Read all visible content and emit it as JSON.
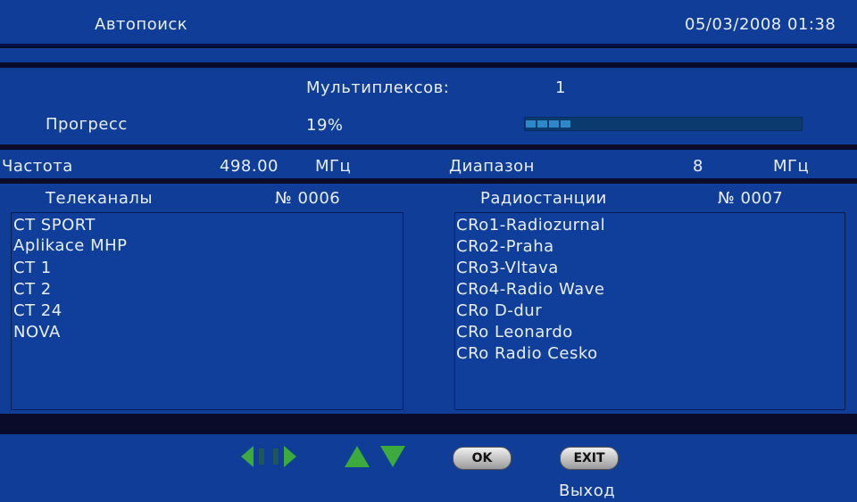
{
  "header": {
    "title": "Автопоиск",
    "datetime": "05/03/2008 01:38"
  },
  "scan": {
    "multiplex_label": "Мультиплексов:",
    "multiplex_value": "1",
    "progress_label": "Прогресс",
    "progress_value": "19%",
    "progress_fraction": 0.19
  },
  "frequency": {
    "label": "Частота",
    "value": "498.00",
    "unit": "МГц",
    "range_label": "Диапазон",
    "range_value": "8",
    "range_unit": "МГц"
  },
  "tv": {
    "header": "Телеканалы",
    "count": "№ 0006",
    "items": [
      "CT SPORT",
      "Aplikace MHP",
      "CT 1",
      "CT 2",
      "CT 24",
      " NOVA"
    ]
  },
  "radio": {
    "header": "Радиостанции",
    "count": "№ 0007",
    "items": [
      "CRo1-Radiozurnal",
      "CRo2-Praha",
      "CRo3-Vltava",
      "CRo4-Radio Wave",
      "CRo D-dur",
      "CRo Leonardo",
      "CRo Radio Cesko"
    ]
  },
  "footer": {
    "ok_label": "OK",
    "exit_label": "EXIT",
    "exit_caption": "Выход",
    "icons": [
      "left-right-arrows-icon",
      "up-down-arrows-icon"
    ],
    "arrow_color": "#3caa3c"
  }
}
